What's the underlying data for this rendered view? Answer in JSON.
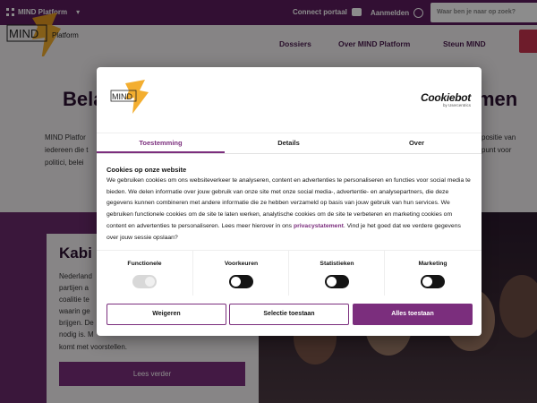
{
  "topbar": {
    "brand": "MIND Platform",
    "link_portal": "Connect portaal",
    "link_login": "Aanmelden",
    "search_placeholder": "Waar ben je naar op zoek?"
  },
  "header": {
    "logo_text": "MIND",
    "logo_sub": "Platform",
    "nav": [
      "Dossiers",
      "Over MIND Platform",
      "Steun MIND"
    ]
  },
  "hero": {
    "title_left": "Bela",
    "title_right": "men",
    "text_left": "MIND Platfor\niedereen die t\npolitici, belei",
    "text_right": "positie van\npunt voor"
  },
  "card": {
    "title": "Kabi",
    "text": "Nederland\npartijen a\ncoalitie te\nwaarin ge\nbrijgen. De\nnodig is. M",
    "text_bottom": "komt met voorstellen.",
    "button": "Lees verder"
  },
  "dialog": {
    "logo_text": "MIND",
    "brand": "Cookiebot",
    "brand_sub": "by Usercentrics",
    "tabs": [
      "Toestemming",
      "Details",
      "Over"
    ],
    "heading": "Cookies op onze website",
    "body": "We gebruiken cookies om ons websiteverkeer te analyseren, content en advertenties te personaliseren en functies voor social media te bieden. We delen informatie over jouw gebruik van onze site met onze social media-, advertentie- en analysepartners, die deze gegevens kunnen combineren met andere informatie die ze hebben verzameld op basis van jouw gebruik van hun services. We gebruiken functionele cookies om de site te laten werken, analytische cookies om de site te verbeteren en marketing cookies om content en advertenties te personaliseren. Lees meer hierover in ons",
    "body_link": "privacystatement",
    "body_end": ". Vind je het goed dat we verdere gegevens over jouw sessie opslaan?",
    "toggles": [
      {
        "label": "Functionele",
        "state": "disabled"
      },
      {
        "label": "Voorkeuren",
        "state": "off"
      },
      {
        "label": "Statistieken",
        "state": "off"
      },
      {
        "label": "Marketing",
        "state": "off"
      }
    ],
    "buttons": {
      "reject": "Weigeren",
      "selection": "Selectie toestaan",
      "accept": "Alles toestaan"
    }
  },
  "colors": {
    "brand_purple": "#7b2e7d",
    "topbar_purple": "#5b1d5e",
    "logo_yellow": "#f2a51a"
  }
}
